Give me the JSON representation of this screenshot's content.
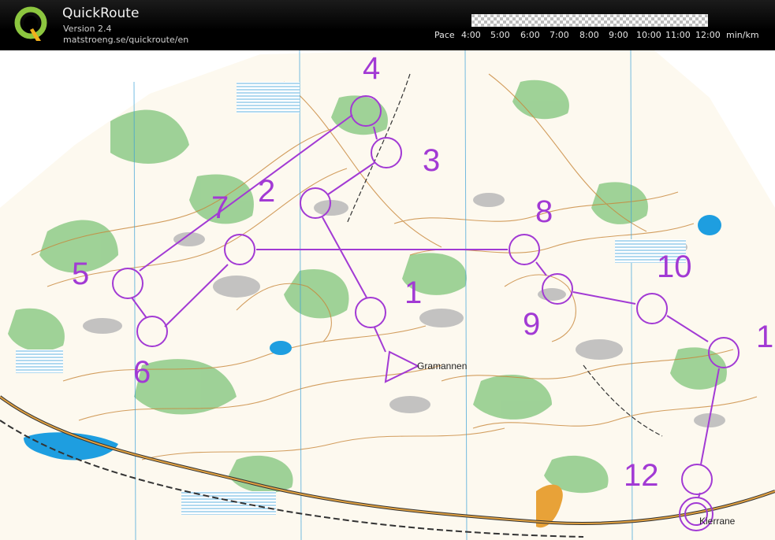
{
  "app": {
    "title": "QuickRoute",
    "version": "Version 2.4",
    "url": "matstroeng.se/quickroute/en"
  },
  "pace_scale": {
    "label": "Pace",
    "ticks": [
      "4:00",
      "5:00",
      "6:00",
      "7:00",
      "8:00",
      "9:00",
      "10:00",
      "11:00",
      "12:00"
    ],
    "unit": "min/km"
  },
  "map": {
    "course_color": "#a23ad4",
    "controls": [
      {
        "label": "1"
      },
      {
        "label": "2"
      },
      {
        "label": "3"
      },
      {
        "label": "4"
      },
      {
        "label": "5"
      },
      {
        "label": "6"
      },
      {
        "label": "7"
      },
      {
        "label": "8"
      },
      {
        "label": "9"
      },
      {
        "label": "10"
      },
      {
        "label": "1"
      },
      {
        "label": "12"
      }
    ],
    "place_names": [
      "Gramannen",
      "Kierrane"
    ]
  }
}
